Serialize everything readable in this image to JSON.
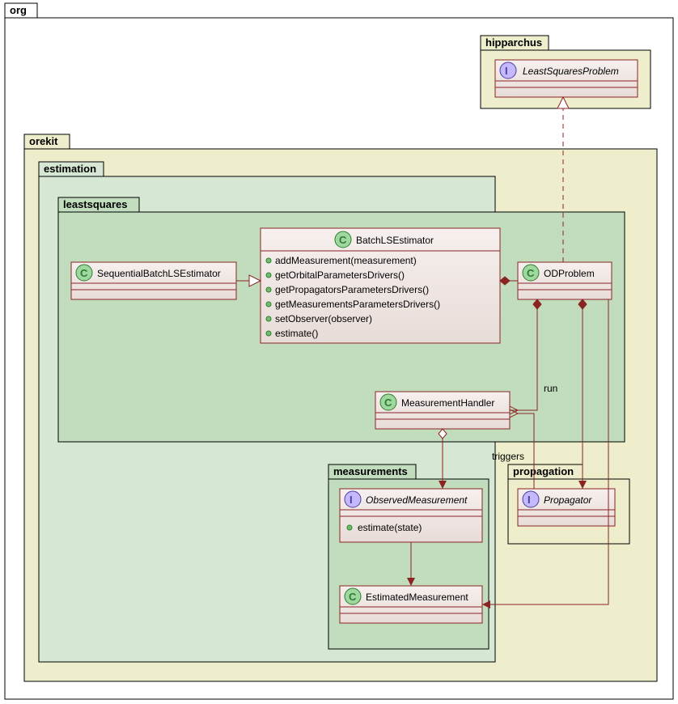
{
  "packages": {
    "root": {
      "label": "org"
    },
    "hipparchus": {
      "label": "hipparchus"
    },
    "orekit": {
      "label": "orekit"
    },
    "estimation": {
      "label": "estimation"
    },
    "leastsquares": {
      "label": "leastsquares"
    },
    "measurements": {
      "label": "measurements"
    },
    "propagation": {
      "label": "propagation"
    }
  },
  "classes": {
    "LeastSquaresProblem": {
      "name": "LeastSquaresProblem",
      "stereotype": "I",
      "italic": true
    },
    "SequentialBatchLSEstimator": {
      "name": "SequentialBatchLSEstimator",
      "stereotype": "C"
    },
    "BatchLSEstimator": {
      "name": "BatchLSEstimator",
      "stereotype": "C",
      "methods": [
        "addMeasurement(measurement)",
        "getOrbitalParametersDrivers()",
        "getPropagatorsParametersDrivers()",
        "getMeasurementsParametersDrivers()",
        "setObserver(observer)",
        "estimate()"
      ]
    },
    "ODProblem": {
      "name": "ODProblem",
      "stereotype": "C"
    },
    "MeasurementHandler": {
      "name": "MeasurementHandler",
      "stereotype": "C"
    },
    "ObservedMeasurement": {
      "name": "ObservedMeasurement",
      "stereotype": "I",
      "italic": true,
      "methods": [
        "estimate(state)"
      ]
    },
    "EstimatedMeasurement": {
      "name": "EstimatedMeasurement",
      "stereotype": "C"
    },
    "Propagator": {
      "name": "Propagator",
      "stereotype": "I",
      "italic": true
    }
  },
  "relations": {
    "run": "run",
    "triggers": "triggers"
  },
  "chart_data": {
    "type": "uml-class-diagram",
    "packages": [
      {
        "name": "org",
        "children": [
          "hipparchus",
          "orekit"
        ]
      },
      {
        "name": "hipparchus",
        "parent": "org",
        "classes": [
          "LeastSquaresProblem"
        ]
      },
      {
        "name": "orekit",
        "parent": "org",
        "children": [
          "estimation",
          "propagation"
        ]
      },
      {
        "name": "estimation",
        "parent": "orekit",
        "children": [
          "leastsquares",
          "measurements"
        ]
      },
      {
        "name": "leastsquares",
        "parent": "estimation",
        "classes": [
          "SequentialBatchLSEstimator",
          "BatchLSEstimator",
          "ODProblem",
          "MeasurementHandler"
        ]
      },
      {
        "name": "measurements",
        "parent": "estimation",
        "classes": [
          "ObservedMeasurement",
          "EstimatedMeasurement"
        ]
      },
      {
        "name": "propagation",
        "parent": "orekit",
        "classes": [
          "Propagator"
        ]
      }
    ],
    "classes": [
      {
        "name": "LeastSquaresProblem",
        "type": "interface"
      },
      {
        "name": "SequentialBatchLSEstimator",
        "type": "class"
      },
      {
        "name": "BatchLSEstimator",
        "type": "class",
        "methods": [
          "addMeasurement(measurement)",
          "getOrbitalParametersDrivers()",
          "getPropagatorsParametersDrivers()",
          "getMeasurementsParametersDrivers()",
          "setObserver(observer)",
          "estimate()"
        ]
      },
      {
        "name": "ODProblem",
        "type": "class"
      },
      {
        "name": "MeasurementHandler",
        "type": "class"
      },
      {
        "name": "ObservedMeasurement",
        "type": "interface",
        "methods": [
          "estimate(state)"
        ]
      },
      {
        "name": "EstimatedMeasurement",
        "type": "class"
      },
      {
        "name": "Propagator",
        "type": "interface"
      }
    ],
    "relations": [
      {
        "from": "ODProblem",
        "to": "LeastSquaresProblem",
        "type": "realization"
      },
      {
        "from": "SequentialBatchLSEstimator",
        "to": "BatchLSEstimator",
        "type": "generalization"
      },
      {
        "from": "BatchLSEstimator",
        "to": "ODProblem",
        "type": "composition"
      },
      {
        "from": "ODProblem",
        "to": "MeasurementHandler",
        "type": "composition",
        "label": "run"
      },
      {
        "from": "MeasurementHandler",
        "to": "ObservedMeasurement",
        "type": "aggregation"
      },
      {
        "from": "ObservedMeasurement",
        "to": "EstimatedMeasurement",
        "type": "association"
      },
      {
        "from": "Propagator",
        "to": "MeasurementHandler",
        "type": "association",
        "label": "triggers"
      },
      {
        "from": "ODProblem",
        "to": "Propagator",
        "type": "composition"
      },
      {
        "from": "ODProblem",
        "to": "EstimatedMeasurement",
        "type": "association"
      }
    ]
  }
}
